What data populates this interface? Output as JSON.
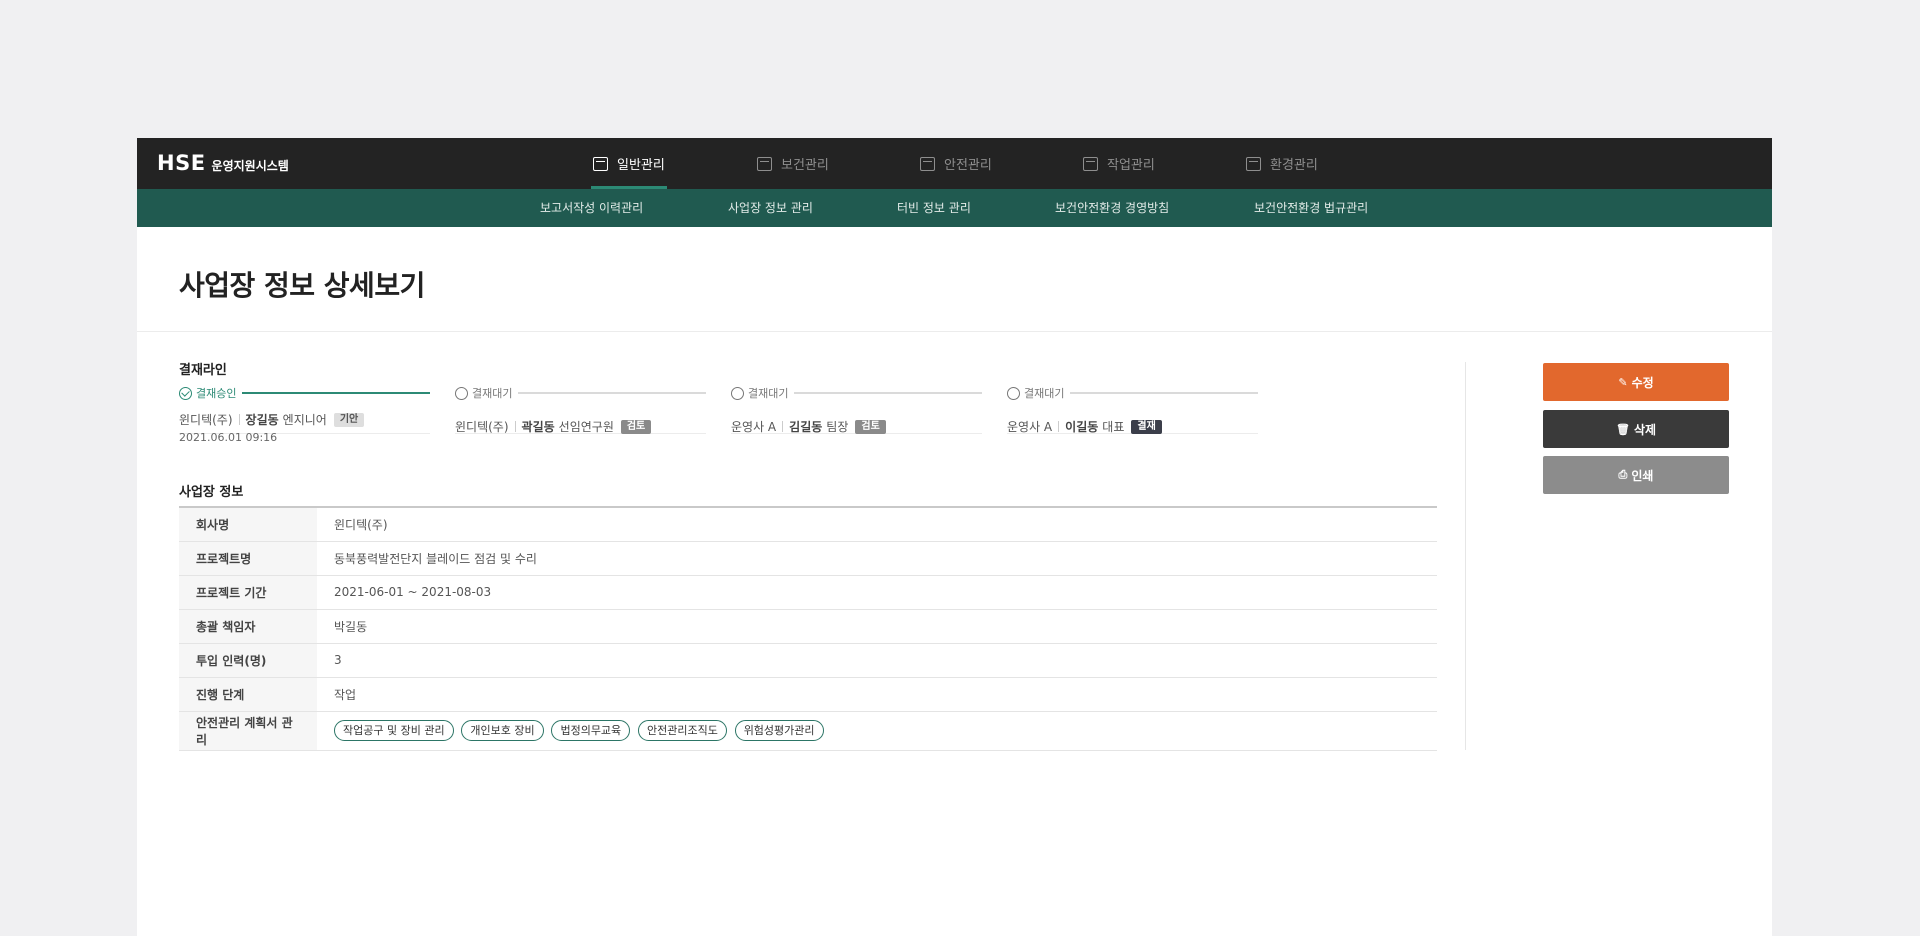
{
  "brand": {
    "name": "HSE",
    "subtitle": "운영지원시스템"
  },
  "menu": [
    {
      "label": "일반관리",
      "active": true
    },
    {
      "label": "보건관리",
      "active": false
    },
    {
      "label": "안전관리",
      "active": false
    },
    {
      "label": "작업관리",
      "active": false
    },
    {
      "label": "환경관리",
      "active": false
    }
  ],
  "submenu": [
    "보고서작성 이력관리",
    "사업장 정보 관리",
    "터빈 정보 관리",
    "보건안전환경 경영방침",
    "보건안전환경 법규관리"
  ],
  "page_title": "사업장 정보 상세보기",
  "approval": {
    "title": "결재라인",
    "steps": [
      {
        "status": "결재승인",
        "company": "윈디텍(주)",
        "person": "장길동",
        "position": "엔지니어",
        "badge": "기안",
        "date": "2021.06.01 09:16"
      },
      {
        "status": "결재대기",
        "company": "윈디텍(주)",
        "person": "곽길동",
        "position": "선임연구원",
        "badge": "검토"
      },
      {
        "status": "결재대기",
        "company": "운영사 A",
        "person": "김길동",
        "position": "팀장",
        "badge": "검토"
      },
      {
        "status": "결재대기",
        "company": "운영사 A",
        "person": "이길동",
        "position": "대표",
        "badge": "결재"
      }
    ]
  },
  "site_info": {
    "title": "사업장 정보",
    "rows": [
      {
        "label": "회사명",
        "value": "윈디텍(주)"
      },
      {
        "label": "프로젝트명",
        "value": "동북풍력발전단지 블레이드 점검 및 수리"
      },
      {
        "label": "프로젝트 기간",
        "value": "2021-06-01 ~ 2021-08-03"
      },
      {
        "label": "총괄 책임자",
        "value": "박길동"
      },
      {
        "label": "투입 인력(명)",
        "value": "3"
      },
      {
        "label": "진행 단계",
        "value": "작업"
      }
    ],
    "plan_label": "안전관리 계획서 관리",
    "plan_chips": [
      "작업공구 및 장비 관리",
      "개인보호 장비",
      "법정의무교육",
      "안전관리조직도",
      "위험성평가관리"
    ]
  },
  "actions": {
    "edit": "수정",
    "delete": "삭제",
    "print": "인쇄"
  },
  "colors": {
    "topbar": "#232323",
    "subbar": "#205a50",
    "accent_green": "#2c8a75",
    "edit_button": "#e2682d",
    "delete_button": "#3a3a3a",
    "print_button": "#8c8c8c"
  }
}
